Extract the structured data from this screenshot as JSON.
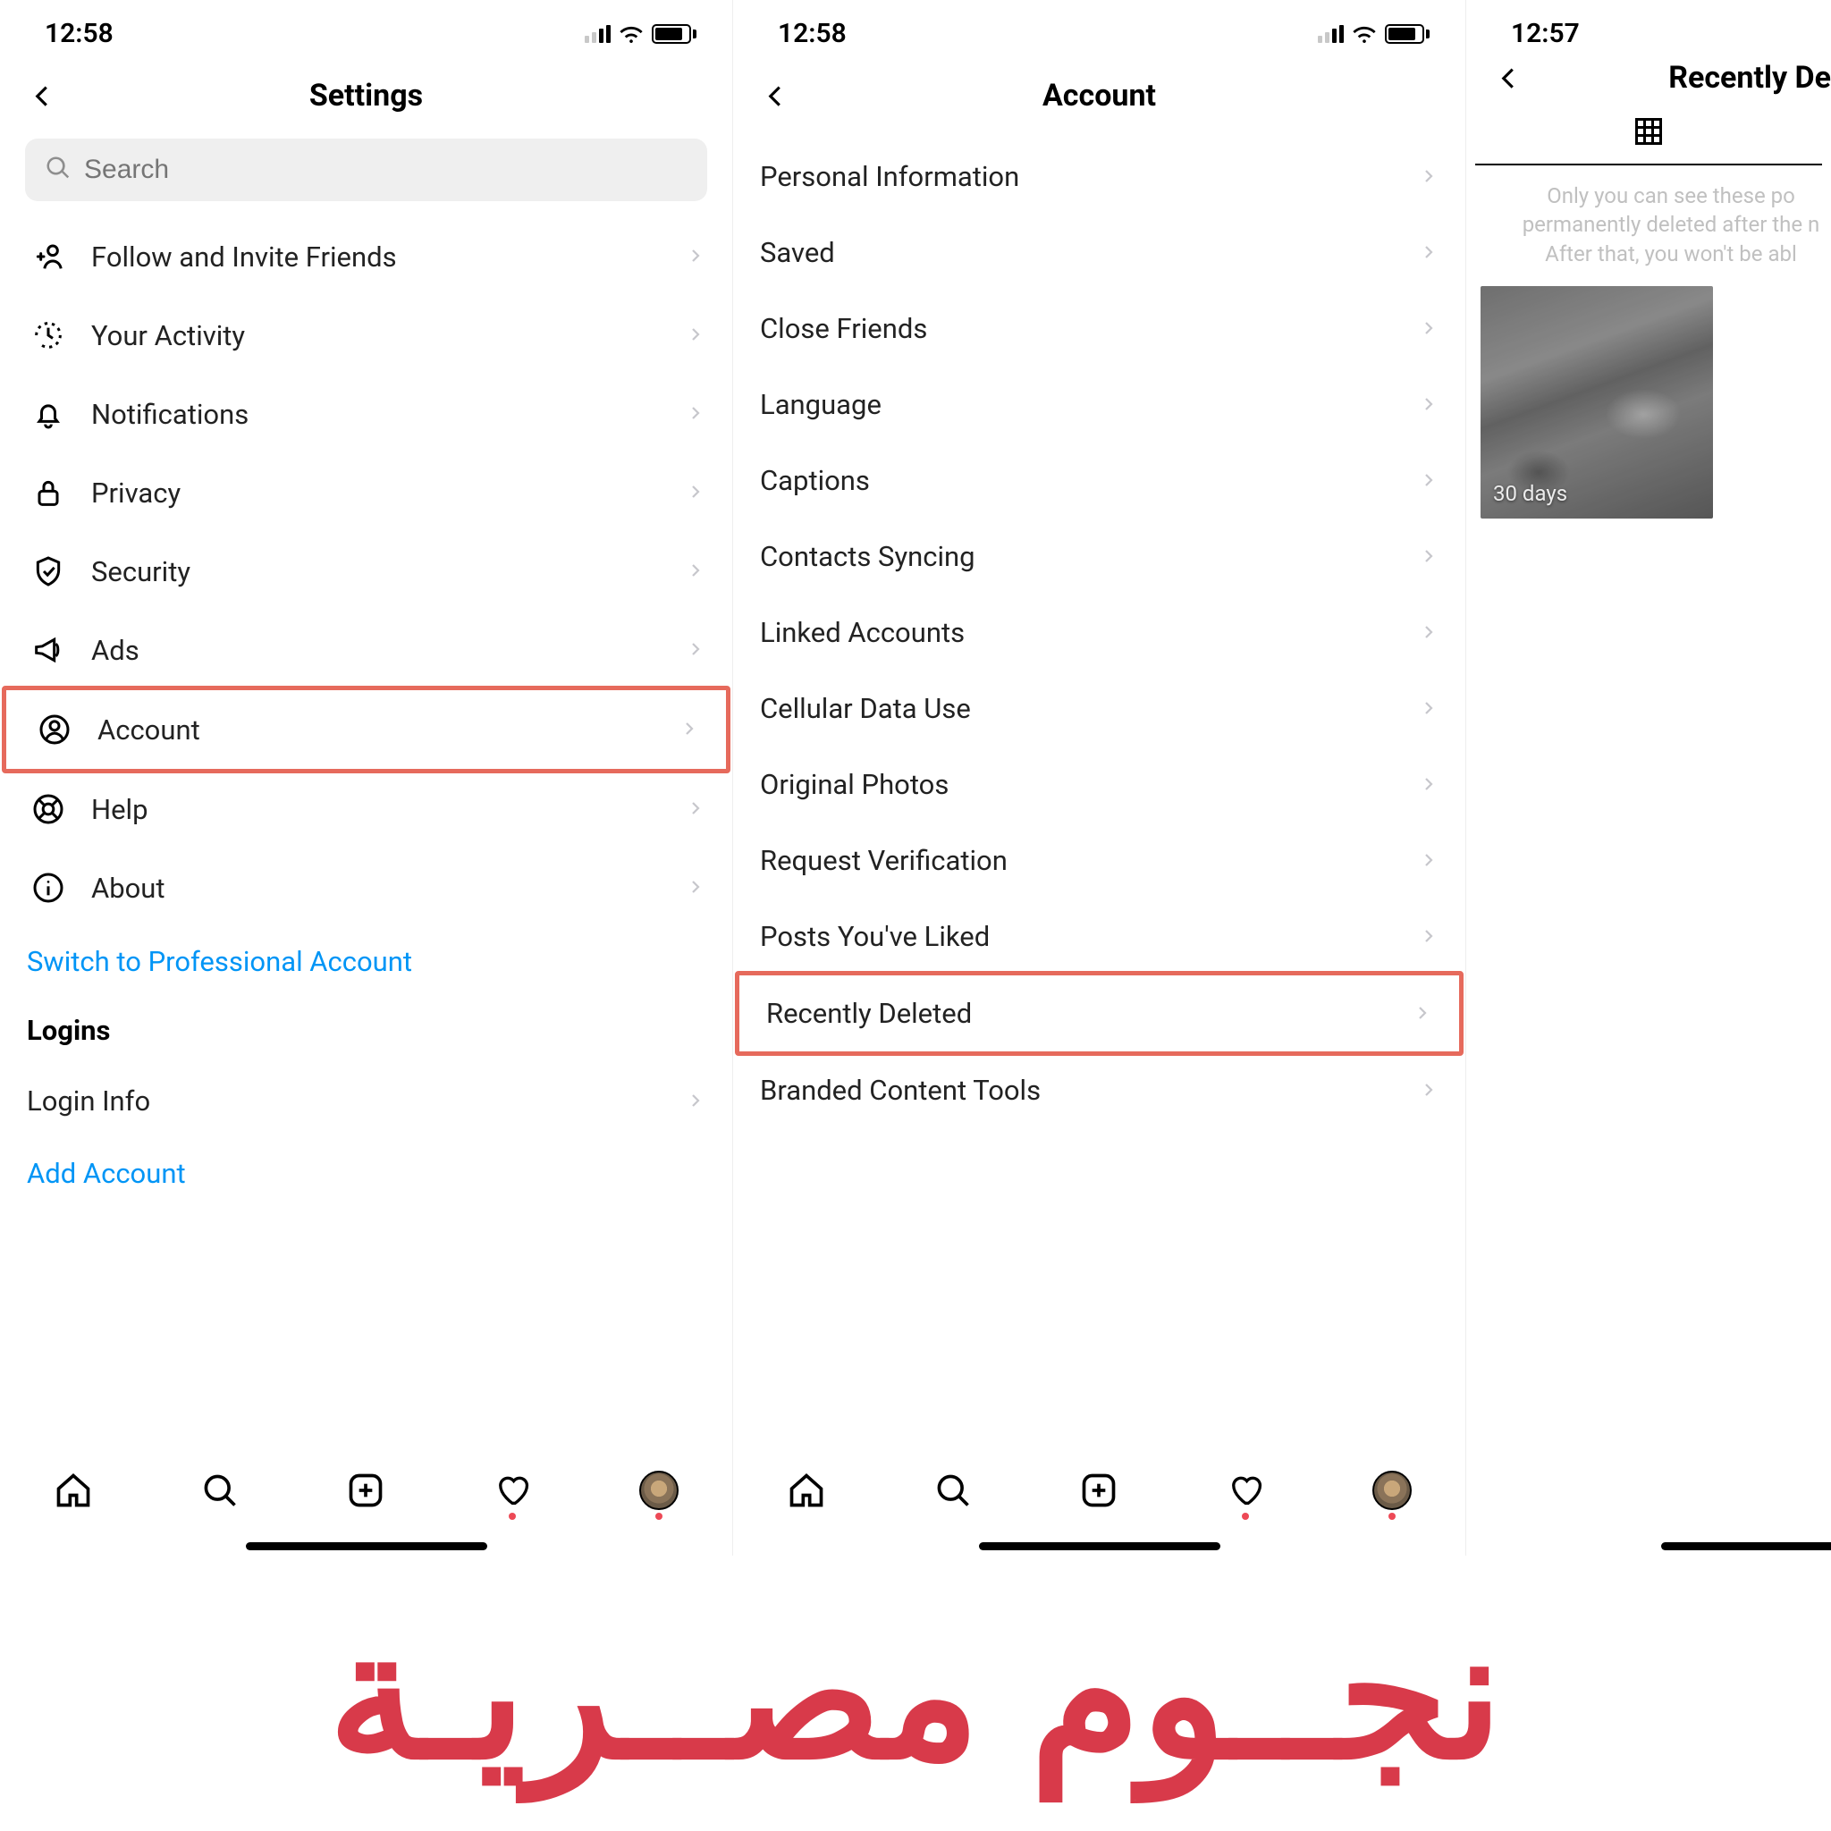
{
  "panel1": {
    "status_time": "12:58",
    "title": "Settings",
    "search_placeholder": "Search",
    "items": [
      "Follow and Invite Friends",
      "Your Activity",
      "Notifications",
      "Privacy",
      "Security",
      "Ads",
      "Account",
      "Help",
      "About"
    ],
    "switch_link": "Switch to Professional Account",
    "logins_header": "Logins",
    "login_info": "Login Info",
    "add_account": "Add Account"
  },
  "panel2": {
    "status_time": "12:58",
    "title": "Account",
    "items": [
      "Personal Information",
      "Saved",
      "Close Friends",
      "Language",
      "Captions",
      "Contacts Syncing",
      "Linked Accounts",
      "Cellular Data Use",
      "Original Photos",
      "Request Verification",
      "Posts You've Liked",
      "Recently Deleted",
      "Branded Content Tools"
    ]
  },
  "panel3": {
    "status_time": "12:57",
    "title": "Recently De",
    "info_line1": "Only you can see these po",
    "info_line2": "permanently deleted after the n",
    "info_line3": "After that, you won't be abl",
    "thumb_badge": "30 days"
  },
  "watermark_text": "نجــوم مصــريـة"
}
